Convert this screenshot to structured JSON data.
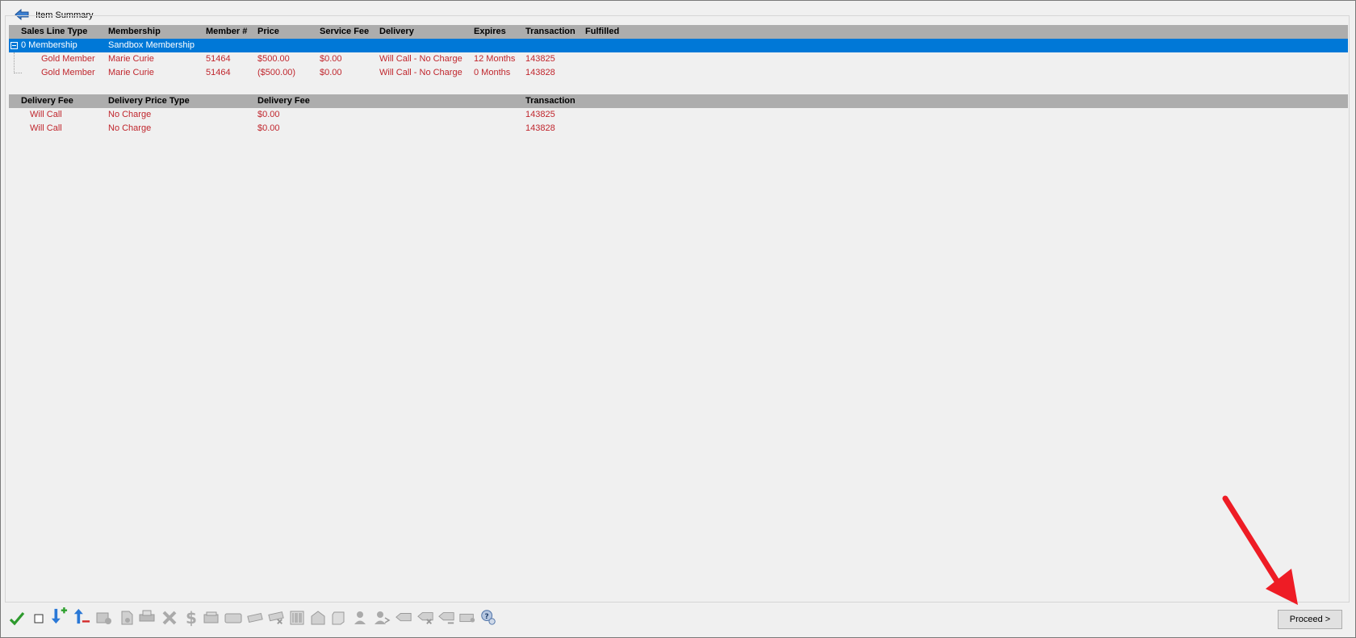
{
  "panel": {
    "title": "Item Summary"
  },
  "items_grid": {
    "columns": [
      "Sales Line Type",
      "Membership",
      "Member #",
      "Price",
      "Service Fee",
      "Delivery",
      "Expires",
      "Transaction",
      "Fulfilled"
    ],
    "group": {
      "type": "0 Membership",
      "membership": "Sandbox Membership"
    },
    "rows": [
      {
        "type": "Gold Member",
        "membership": "Marie Curie",
        "member_no": "51464",
        "price": "$500.00",
        "service_fee": "$0.00",
        "delivery": "Will Call - No Charge",
        "expires": "12 Months",
        "transaction": "143825",
        "fulfilled": "",
        "voided": true
      },
      {
        "type": "Gold Member",
        "membership": "Marie Curie",
        "member_no": "51464",
        "price": "($500.00)",
        "service_fee": "$0.00",
        "delivery": "Will Call - No Charge",
        "expires": "0 Months",
        "transaction": "143828",
        "fulfilled": "",
        "voided": false
      }
    ]
  },
  "delivery_grid": {
    "columns": [
      "Delivery Fee",
      "Delivery Price Type",
      "Delivery Fee",
      "Transaction"
    ],
    "rows": [
      {
        "delivery_fee": "Will Call",
        "price_type": "No Charge",
        "fee": "$0.00",
        "transaction": "143825",
        "voided": true
      },
      {
        "delivery_fee": "Will Call",
        "price_type": "No Charge",
        "fee": "$0.00",
        "transaction": "143828",
        "voided": false
      }
    ]
  },
  "toolbar": {
    "icons": [
      "check-icon",
      "checkbox-icon",
      "move-down-add-icon",
      "move-up-remove-icon",
      "ticket-info-icon",
      "document-info-icon",
      "print-icon",
      "delete-icon",
      "dollar-icon",
      "gift-icon",
      "card-icon",
      "voucher-icon",
      "voucher-remove-icon",
      "barcode-icon",
      "envelope-icon",
      "scroll-icon",
      "person-icon",
      "person-swap-icon",
      "tag-icon",
      "tag-remove-icon",
      "tag-edit-icon",
      "ticket-icon",
      "help-icon"
    ]
  },
  "proceed_button": {
    "label": "Proceed >"
  },
  "colors": {
    "selected": "#0078d7",
    "header": "#adadad",
    "void_text": "#c0262d",
    "annotation_arrow": "#ee1c25"
  }
}
